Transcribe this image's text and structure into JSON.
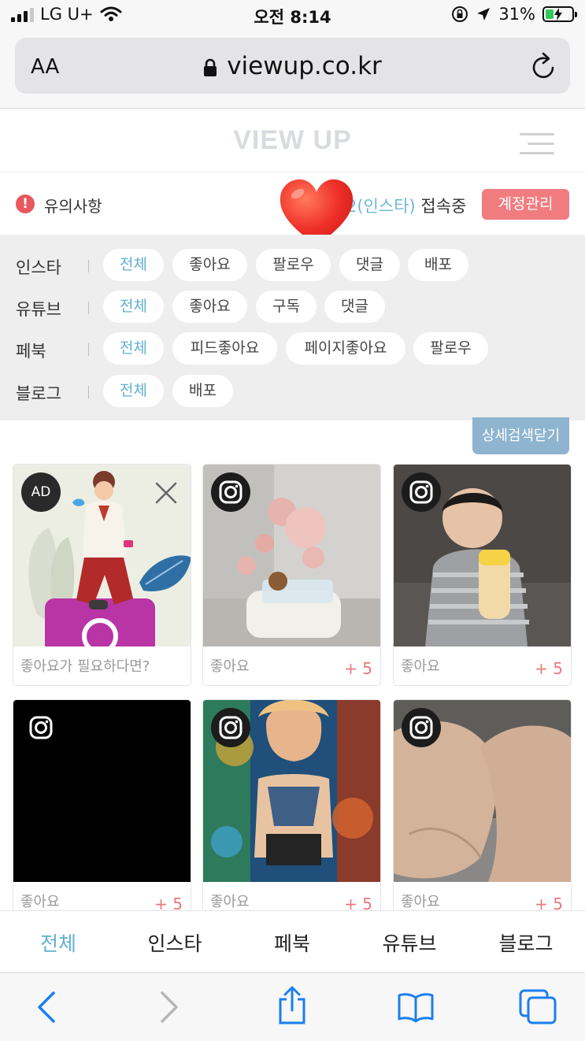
{
  "status_bar": {
    "carrier": "LG U+",
    "time": "오전 8:14",
    "battery": "31%",
    "battery_level": 0.31
  },
  "browser": {
    "text_size_label": "AA",
    "url": "viewup.co.kr"
  },
  "header": {
    "logo": "VIEW UP"
  },
  "notice": {
    "warning_label": "유의사항",
    "account_fragment": "2(인스타)",
    "connected_label": "접속중",
    "account_button": "계정관리"
  },
  "filters": [
    {
      "label": "인스타",
      "chips": [
        "전체",
        "좋아요",
        "팔로우",
        "댓글",
        "배포"
      ]
    },
    {
      "label": "유튜브",
      "chips": [
        "전체",
        "좋아요",
        "구독",
        "댓글"
      ]
    },
    {
      "label": "페북",
      "chips": [
        "전체",
        "피드좋아요",
        "페이지좋아요",
        "팔로우"
      ]
    },
    {
      "label": "블로그",
      "chips": [
        "전체",
        "배포"
      ]
    }
  ],
  "close_search_button": "상세검색닫기",
  "cards": [
    {
      "badge": "AD",
      "caption": "좋아요가 필요하다면?",
      "reward": ""
    },
    {
      "badge": "instagram-icon",
      "caption": "좋아요",
      "reward": "+ 5"
    },
    {
      "badge": "instagram-icon",
      "caption": "좋아요",
      "reward": "+ 5"
    },
    {
      "badge": "instagram-icon",
      "caption": "좋아요",
      "reward": "+ 5"
    },
    {
      "badge": "instagram-icon",
      "caption": "좋아요",
      "reward": "+ 5"
    },
    {
      "badge": "instagram-icon",
      "caption": "좋아요",
      "reward": "+ 5"
    }
  ],
  "bottom_tabs": [
    "전체",
    "인스타",
    "페북",
    "유튜브",
    "블로그"
  ],
  "colors": {
    "accent": "#5fb0d2",
    "button_red": "#f07c80",
    "reward_red": "#e8787c",
    "close_blue": "#8eb4cf"
  }
}
